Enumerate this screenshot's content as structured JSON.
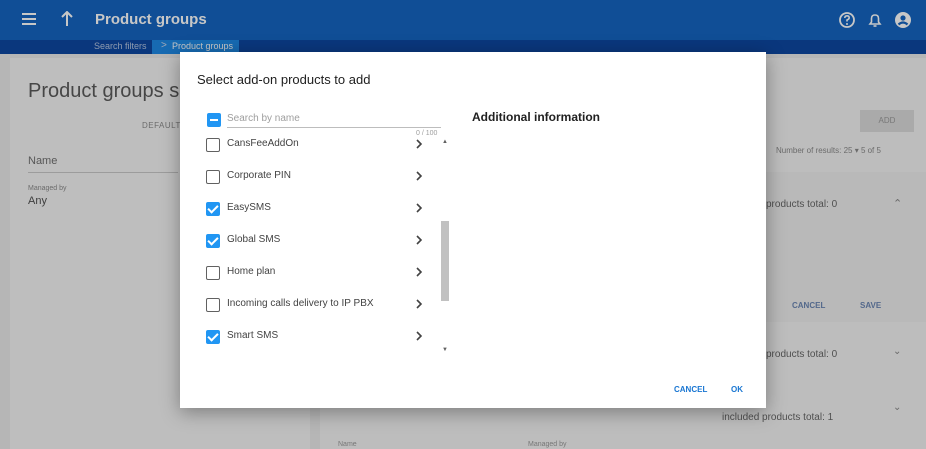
{
  "header": {
    "title": "Product groups",
    "menu_icon": "hamburger-icon",
    "up_icon": "arrow-up-icon",
    "help_icon": "help-circle-icon",
    "bell_icon": "bell-icon",
    "account_icon": "account-circle-icon"
  },
  "breadcrumb": {
    "items": [
      "Search filters",
      "Product groups"
    ],
    "separator": ">"
  },
  "background": {
    "title": "Product groups searc",
    "default_tab": "DEFAULT F",
    "name_label": "Name",
    "managed_by_label": "Managed by",
    "managed_by_value": "Any",
    "add_label": "ADD",
    "results_text": "Number of results:  25  ▾   5 of 5",
    "group1_total": "products total: 0",
    "cancel_label": "CANCEL",
    "save_label": "SAVE",
    "group2_total": "products total: 0",
    "group3_total": "included products total: 1",
    "col_name": "Name",
    "col_managed_by": "Managed by"
  },
  "dialog": {
    "title": "Select add-on products to add",
    "search_placeholder": "Search by name",
    "counter": "0 / 100",
    "info_title": "Additional information",
    "cancel_label": "CANCEL",
    "ok_label": "OK",
    "items": [
      {
        "label": "CansFeeAddOn",
        "checked": false
      },
      {
        "label": "Corporate PIN",
        "checked": false
      },
      {
        "label": "EasySMS",
        "checked": true
      },
      {
        "label": "Global SMS",
        "checked": true
      },
      {
        "label": "Home plan",
        "checked": false
      },
      {
        "label": "Incoming calls delivery to IP PBX",
        "checked": false
      },
      {
        "label": "Smart SMS",
        "checked": true
      }
    ]
  },
  "colors": {
    "primary": "#1565c0",
    "primary_dark": "#0d47a1",
    "accent": "#2196f3"
  }
}
